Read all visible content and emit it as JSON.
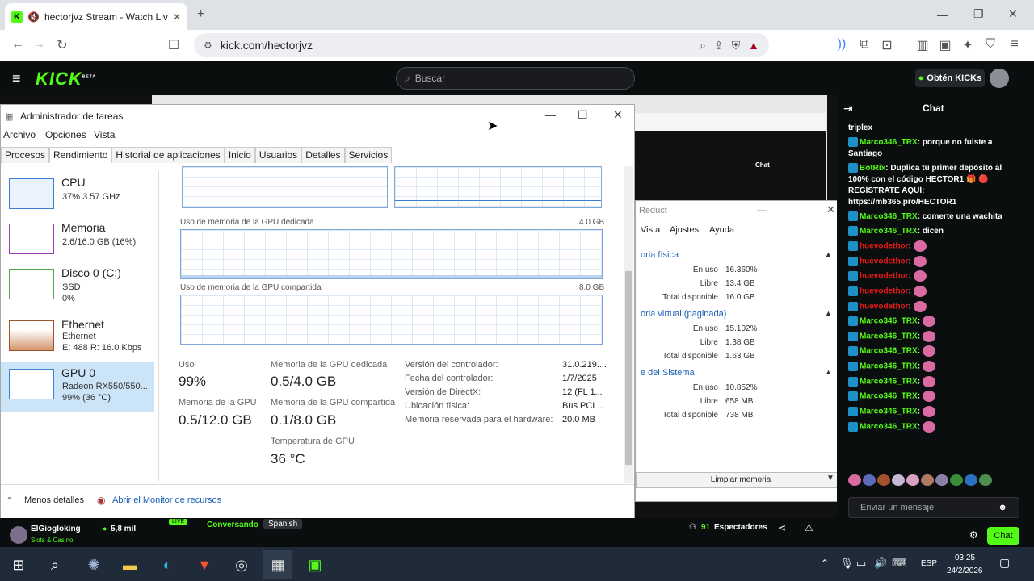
{
  "browser": {
    "tab_title": "hectorjvz Stream - Watch Live",
    "url": "kick.com/hectorjvz"
  },
  "kick": {
    "logo": "KICK",
    "logo_badge": "BETA",
    "search_placeholder": "Buscar",
    "get_kicks": "Obtén KICKs",
    "chat_title": "Chat",
    "chat_messages": [
      {
        "user": "",
        "text": "triplex"
      },
      {
        "user": "Marco346_TRX",
        "text": "porque no fuiste a Santiago"
      },
      {
        "user": "BotRix",
        "text": "Duplica tu primer depósito al 100% con el código HECTOR1 🎁 🔴 REGÍSTRATE AQUÍ: https://mb365.pro/HECTOR1"
      },
      {
        "user": "Marco346_TRX",
        "text": "comerte una wachita"
      },
      {
        "user": "Marco346_TRX",
        "text": "dicen"
      },
      {
        "user": "huevodethor",
        "text": ""
      },
      {
        "user": "huevodethor",
        "text": ""
      },
      {
        "user": "huevodethor",
        "text": ""
      },
      {
        "user": "huevodethor",
        "text": ""
      },
      {
        "user": "huevodethor",
        "text": ""
      },
      {
        "user": "Marco346_TRX",
        "text": ""
      },
      {
        "user": "Marco346_TRX",
        "text": ""
      },
      {
        "user": "Marco346_TRX",
        "text": ""
      },
      {
        "user": "Marco346_TRX",
        "text": ""
      },
      {
        "user": "Marco346_TRX",
        "text": ""
      },
      {
        "user": "Marco346_TRX",
        "text": ""
      },
      {
        "user": "Marco346_TRX",
        "text": ""
      },
      {
        "user": "Marco346_TRX",
        "text": ""
      }
    ],
    "chat_input_placeholder": "Enviar un mensaje",
    "chat_button": "Chat",
    "viewers_count": "91",
    "viewers_label": "Espectadores",
    "streamer_name": "ElGiogloking",
    "streamer_category": "Slots & Casino",
    "followers": "5,8 mil",
    "live_badge": "LIVE",
    "tag1": "Conversando",
    "tag2": "Spanish"
  },
  "taskmgr": {
    "title": "Administrador de tareas",
    "menu": [
      "Archivo",
      "Opciones",
      "Vista"
    ],
    "tabs": [
      "Procesos",
      "Rendimiento",
      "Historial de aplicaciones",
      "Inicio",
      "Usuarios",
      "Detalles",
      "Servicios"
    ],
    "sidebar": [
      {
        "name": "CPU",
        "sub1": "37% 3.57 GHz",
        "sub2": "",
        "sub3": ""
      },
      {
        "name": "Memoria",
        "sub1": "2.6/16.0 GB (16%)",
        "sub2": "",
        "sub3": ""
      },
      {
        "name": "Disco 0 (C:)",
        "sub1": "SSD",
        "sub2": "0%",
        "sub3": ""
      },
      {
        "name": "Ethernet",
        "sub1": "Ethernet",
        "sub2": "E: 488 R: 16.0 Kbps",
        "sub3": ""
      },
      {
        "name": "GPU 0",
        "sub1": "Radeon RX550/550...",
        "sub2": "99% (36 °C)",
        "sub3": ""
      }
    ],
    "graph_dedicated_label": "Uso de memoria de la GPU dedicada",
    "graph_dedicated_max": "4.0 GB",
    "graph_shared_label": "Uso de memoria de la GPU compartida",
    "graph_shared_max": "8.0 GB",
    "stats": {
      "uso_label": "Uso",
      "uso_value": "99%",
      "ded_label": "Memoria de la GPU dedicada",
      "ded_value": "0.5/4.0 GB",
      "gpu_mem_label": "Memoria de la GPU",
      "gpu_mem_value": "0.5/12.0 GB",
      "shared_label": "Memoria de la GPU compartida",
      "shared_value": "0.1/8.0 GB",
      "temp_label": "Temperatura de GPU",
      "temp_value": "36 °C"
    },
    "details": [
      {
        "k": "Versión del controlador:",
        "v": "31.0.219...."
      },
      {
        "k": "Fecha del controlador:",
        "v": "1/7/2025"
      },
      {
        "k": "Versión de DirectX:",
        "v": "12 (FL 1..."
      },
      {
        "k": "Ubicación física:",
        "v": "Bus PCI ..."
      },
      {
        "k": "Memoria reservada para el hardware:",
        "v": "20.0 MB"
      }
    ],
    "fewer_details": "Menos detalles",
    "resource_monitor": "Abrir el Monitor de recursos"
  },
  "reduct": {
    "title": "Reduct",
    "menu": [
      "Vista",
      "Ajustes",
      "Ayuda"
    ],
    "sections": [
      {
        "title": "oria física",
        "rows": [
          [
            "En uso",
            "16.360%"
          ],
          [
            "Libre",
            "13.4 GB"
          ],
          [
            "Total disponible",
            "16.0 GB"
          ]
        ]
      },
      {
        "title": "oria virtual (paginada)",
        "rows": [
          [
            "En uso",
            "15.102%"
          ],
          [
            "Libre",
            "1.38 GB"
          ],
          [
            "Total disponible",
            "1.63 GB"
          ]
        ]
      },
      {
        "title": "e del Sistema",
        "rows": [
          [
            "En uso",
            "10.852%"
          ],
          [
            "Libre",
            "658 MB"
          ],
          [
            "Total disponible",
            "738 MB"
          ]
        ]
      }
    ],
    "clean_button": "Limpiar memoria"
  },
  "taskbar": {
    "time": "03:25",
    "date": "24/2/2026",
    "lang": "ESP"
  },
  "colors": {
    "kick_green": "#53fc18",
    "taskbar": "#1f2b38"
  }
}
